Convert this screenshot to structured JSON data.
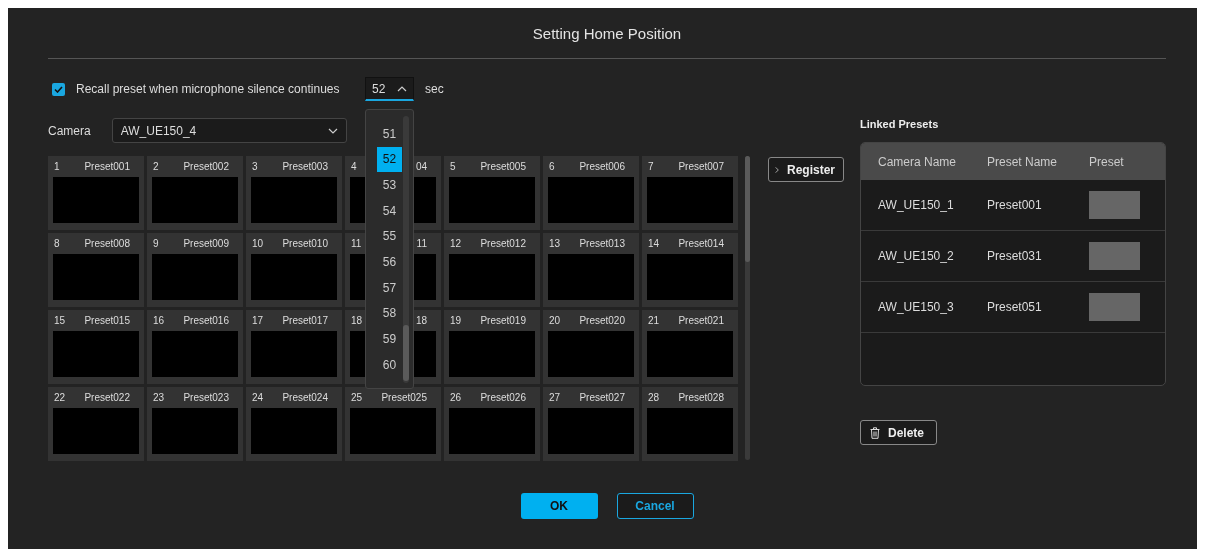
{
  "dialog": {
    "title": "Setting Home Position"
  },
  "recall": {
    "label": "Recall preset when microphone silence continues",
    "checked": true
  },
  "silence_time": {
    "value": "52",
    "unit": "sec",
    "expanded": true,
    "options": [
      {
        "label": "51",
        "selected": false
      },
      {
        "label": "52",
        "selected": true
      },
      {
        "label": "53",
        "selected": false
      },
      {
        "label": "54",
        "selected": false
      },
      {
        "label": "55",
        "selected": false
      },
      {
        "label": "56",
        "selected": false
      },
      {
        "label": "57",
        "selected": false
      },
      {
        "label": "58",
        "selected": false
      },
      {
        "label": "59",
        "selected": false
      },
      {
        "label": "60",
        "selected": false
      }
    ]
  },
  "camera": {
    "label": "Camera",
    "value": "AW_UE150_4"
  },
  "presets": [
    {
      "number": "1",
      "name": "Preset001"
    },
    {
      "number": "2",
      "name": "Preset002"
    },
    {
      "number": "3",
      "name": "Preset003"
    },
    {
      "number": "4",
      "name": "04"
    },
    {
      "number": "5",
      "name": "Preset005"
    },
    {
      "number": "6",
      "name": "Preset006"
    },
    {
      "number": "7",
      "name": "Preset007"
    },
    {
      "number": "8",
      "name": "Preset008"
    },
    {
      "number": "9",
      "name": "Preset009"
    },
    {
      "number": "10",
      "name": "Preset010"
    },
    {
      "number": "11",
      "name": "11"
    },
    {
      "number": "12",
      "name": "Preset012"
    },
    {
      "number": "13",
      "name": "Preset013"
    },
    {
      "number": "14",
      "name": "Preset014"
    },
    {
      "number": "15",
      "name": "Preset015"
    },
    {
      "number": "16",
      "name": "Preset016"
    },
    {
      "number": "17",
      "name": "Preset017"
    },
    {
      "number": "18",
      "name": "18"
    },
    {
      "number": "19",
      "name": "Preset019"
    },
    {
      "number": "20",
      "name": "Preset020"
    },
    {
      "number": "21",
      "name": "Preset021"
    },
    {
      "number": "22",
      "name": "Preset022"
    },
    {
      "number": "23",
      "name": "Preset023"
    },
    {
      "number": "24",
      "name": "Preset024"
    },
    {
      "number": "25",
      "name": "Preset025"
    },
    {
      "number": "26",
      "name": "Preset026"
    },
    {
      "number": "27",
      "name": "Preset027"
    },
    {
      "number": "28",
      "name": "Preset028"
    }
  ],
  "register_button": "Register",
  "linked_presets": {
    "title": "Linked Presets",
    "columns": [
      "Camera Name",
      "Preset Name",
      "Preset"
    ],
    "rows": [
      {
        "camera_name": "AW_UE150_1",
        "preset_name": "Preset001"
      },
      {
        "camera_name": "AW_UE150_2",
        "preset_name": "Preset031"
      },
      {
        "camera_name": "AW_UE150_3",
        "preset_name": "Preset051"
      }
    ]
  },
  "delete_button": "Delete",
  "ok_button": "OK",
  "cancel_button": "Cancel"
}
